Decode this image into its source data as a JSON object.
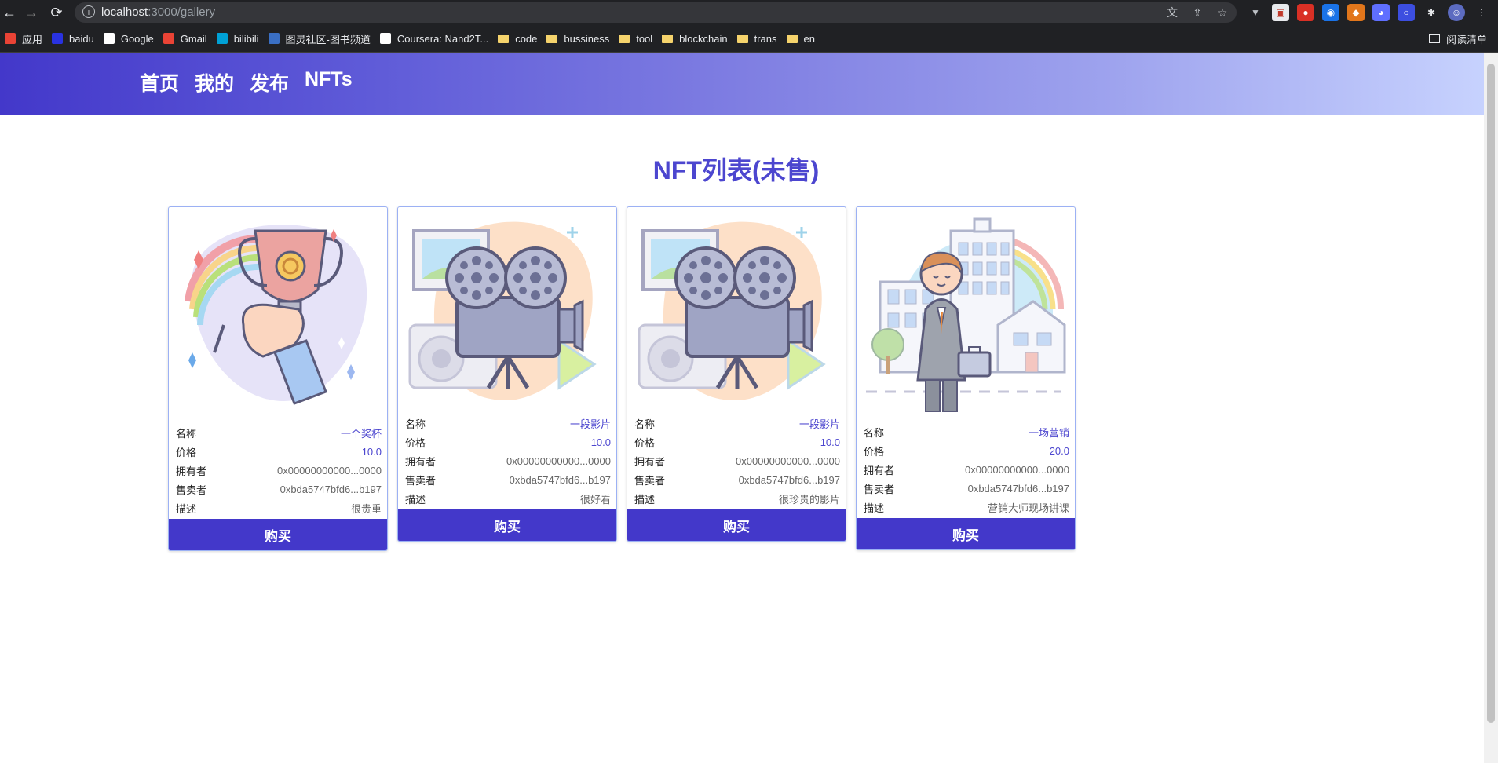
{
  "browser": {
    "url_host": "localhost",
    "url_path": ":3000/gallery",
    "bookmarks": [
      {
        "label": "应用",
        "icon": "apps-grid-icon",
        "color": "#ea4335"
      },
      {
        "label": "baidu",
        "icon": "baidu-paw-icon",
        "color": "#2932e1"
      },
      {
        "label": "Google",
        "icon": "google-g-icon",
        "color": "#ffffff"
      },
      {
        "label": "Gmail",
        "icon": "gmail-icon",
        "color": "#ea4335"
      },
      {
        "label": "bilibili",
        "icon": "bilibili-tv-icon",
        "color": "#00a1d6"
      },
      {
        "label": "图灵社区-图书频道",
        "icon": "turing-book-icon",
        "color": "#3a6fc4"
      },
      {
        "label": "Coursera: Nand2T...",
        "icon": "coursera-icon",
        "color": "#ffffff"
      },
      {
        "label": "code",
        "icon": "folder-icon"
      },
      {
        "label": "bussiness",
        "icon": "folder-icon"
      },
      {
        "label": "tool",
        "icon": "folder-icon"
      },
      {
        "label": "blockchain",
        "icon": "folder-icon"
      },
      {
        "label": "trans",
        "icon": "folder-icon"
      },
      {
        "label": "en",
        "icon": "folder-icon"
      }
    ],
    "reading_list": "阅读清单"
  },
  "nav": {
    "home": "首页",
    "mine": "我的",
    "publish": "发布",
    "nfts": "NFTs"
  },
  "page_title": "NFT列表(未售)",
  "labels": {
    "name": "名称",
    "price": "价格",
    "owner": "拥有者",
    "seller": "售卖者",
    "desc": "描述",
    "buy": "购买"
  },
  "cards": [
    {
      "name": "一个奖杯",
      "price": "10.0",
      "owner": "0x00000000000...0000",
      "seller": "0xbda5747bfd6...b197",
      "desc": "很贵重",
      "image": "trophy-illustration"
    },
    {
      "name": "一段影片",
      "price": "10.0",
      "owner": "0x00000000000...0000",
      "seller": "0xbda5747bfd6...b197",
      "desc": "很好看",
      "image": "film-camera-illustration"
    },
    {
      "name": "一段影片",
      "price": "10.0",
      "owner": "0x00000000000...0000",
      "seller": "0xbda5747bfd6...b197",
      "desc": "很珍贵的影片",
      "image": "film-camera-illustration"
    },
    {
      "name": "一场营销",
      "price": "20.0",
      "owner": "0x00000000000...0000",
      "seller": "0xbda5747bfd6...b197",
      "desc": "营销大师现场讲课",
      "image": "businessman-illustration"
    }
  ],
  "colors": {
    "accent": "#4338ca",
    "title": "#4c46cf",
    "card_border": "#9cb1f4"
  }
}
